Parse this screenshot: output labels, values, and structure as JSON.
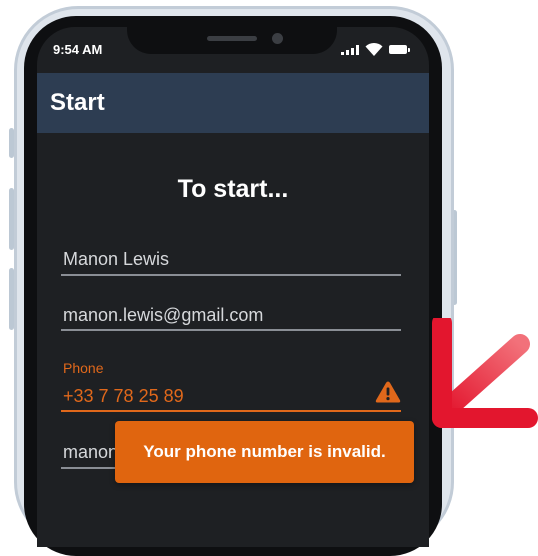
{
  "status_bar": {
    "time": "9:54 AM"
  },
  "app_bar": {
    "title": "Start"
  },
  "form": {
    "heading": "To start...",
    "name_value": "Manon Lewis",
    "email_value": "manon.lewis@gmail.com",
    "phone_label": "Phone",
    "phone_value": "+33 7 78 25 89",
    "partial_field_value": "manon"
  },
  "toast": {
    "message": "Your phone number is invalid."
  },
  "colors": {
    "app_bar": "#2d3d52",
    "screen_background": "#1e2023",
    "error_accent": "#e0681b",
    "toast_background": "#e0650f",
    "arrow": "#e8363e"
  },
  "icons": [
    "signal-icon",
    "wifi-icon",
    "battery-icon",
    "warning-icon",
    "arrow-pointer-icon"
  ]
}
